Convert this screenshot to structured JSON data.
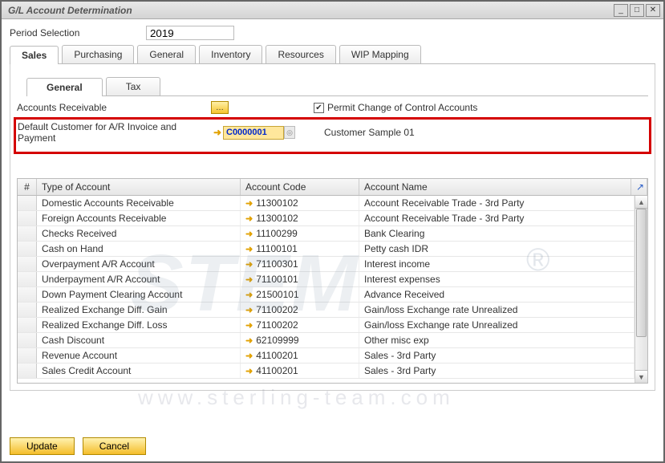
{
  "window": {
    "title": "G/L Account Determination",
    "buttons": {
      "min": "_",
      "max": "□",
      "close": "✕"
    }
  },
  "period": {
    "label": "Period Selection",
    "value": "2019"
  },
  "tabs": [
    "Sales",
    "Purchasing",
    "General",
    "Inventory",
    "Resources",
    "WIP Mapping"
  ],
  "subtabs": [
    "General",
    "Tax"
  ],
  "accounts_receivable": {
    "label": "Accounts Receivable",
    "browse": "…"
  },
  "permit": {
    "label": "Permit Change of Control Accounts",
    "checked": true
  },
  "default_customer": {
    "label": "Default Customer for A/R Invoice and Payment",
    "code": "C0000001",
    "name": "Customer Sample 01"
  },
  "grid": {
    "headers": {
      "num": "#",
      "type": "Type of Account",
      "code": "Account Code",
      "name": "Account Name"
    },
    "rows": [
      {
        "type": "Domestic Accounts Receivable",
        "code": "11300102",
        "name": "Account Receivable Trade - 3rd Party"
      },
      {
        "type": "Foreign Accounts Receivable",
        "code": "11300102",
        "name": "Account Receivable Trade - 3rd Party"
      },
      {
        "type": "Checks Received",
        "code": "11100299",
        "name": "Bank Clearing"
      },
      {
        "type": "Cash on Hand",
        "code": "11100101",
        "name": "Petty cash IDR"
      },
      {
        "type": "Overpayment A/R Account",
        "code": "71100301",
        "name": "Interest income"
      },
      {
        "type": "Underpayment A/R Account",
        "code": "71100101",
        "name": "Interest expenses"
      },
      {
        "type": "Down Payment Clearing Account",
        "code": "21500101",
        "name": "Advance Received"
      },
      {
        "type": "Realized Exchange Diff. Gain",
        "code": "71100202",
        "name": "Gain/loss  Exchange rate Unrealized"
      },
      {
        "type": "Realized Exchange Diff. Loss",
        "code": "71100202",
        "name": "Gain/loss  Exchange rate Unrealized"
      },
      {
        "type": "Cash Discount",
        "code": "62109999",
        "name": "Other misc exp"
      },
      {
        "type": "Revenue Account",
        "code": "41100201",
        "name": "Sales - 3rd Party"
      },
      {
        "type": "Sales Credit Account",
        "code": "41100201",
        "name": "Sales - 3rd Party"
      }
    ]
  },
  "footer": {
    "update": "Update",
    "cancel": "Cancel"
  },
  "watermark": {
    "text": "STEM",
    "reg": "®",
    "url": "www.sterling-team.com"
  }
}
